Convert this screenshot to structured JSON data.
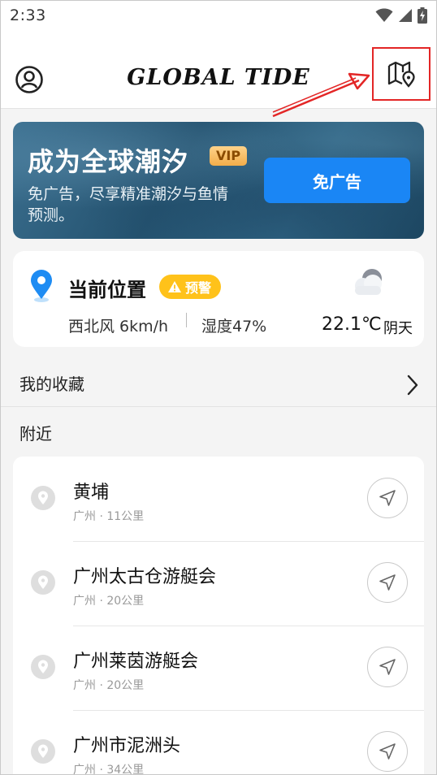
{
  "status_bar": {
    "time": "2:33",
    "icons": [
      "wifi-icon",
      "signal-icon",
      "battery-charging-icon"
    ]
  },
  "header": {
    "title": "GLOBAL  TIDE",
    "left_icon": "profile-icon",
    "right_icon": "map-location-icon",
    "highlight_color": "#e32626"
  },
  "vip_banner": {
    "title": "成为全球潮汐",
    "badge": "VIP",
    "description": "免广告，尽享精准潮汐与鱼情预测。",
    "button_label": "免广告",
    "button_color": "#1a86f5"
  },
  "current_location": {
    "title": "当前位置",
    "warning_badge": "预警",
    "warning_color": "#ffc21a",
    "wind": "西北风 6km/h",
    "humidity": "湿度47%",
    "temperature": "22.1℃",
    "condition": "阴天",
    "weather_icon": "cloudy-icon"
  },
  "favorites": {
    "label": "我的收藏"
  },
  "nearby": {
    "label": "附近",
    "items": [
      {
        "name": "黄埔",
        "meta": "广州 · 11公里"
      },
      {
        "name": "广州太古仓游艇会",
        "meta": "广州 · 20公里"
      },
      {
        "name": "广州莱茵游艇会",
        "meta": "广州 · 20公里"
      },
      {
        "name": "广州市泥洲头",
        "meta": "广州 · 34公里"
      }
    ]
  }
}
